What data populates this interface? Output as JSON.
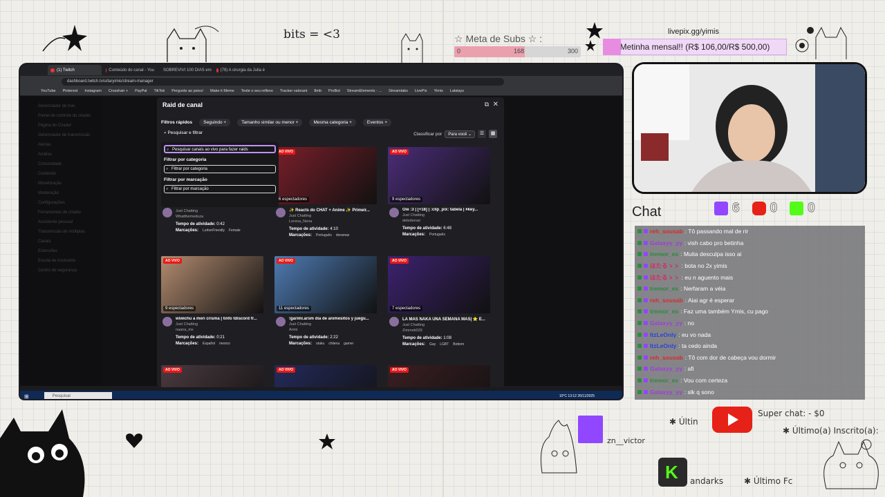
{
  "doodles": {
    "bits": "bits = <3"
  },
  "subs": {
    "title": "☆ Meta de Subs ☆ :",
    "min": "0",
    "current": "168",
    "max": "300",
    "fill_fraction": 0.56,
    "color": "#eba0ae"
  },
  "livepix": {
    "url": "livepix.gg/yimis",
    "goal": "Metinha mensal!! (R$ 106,00/R$ 500,00)"
  },
  "browser": {
    "tabs": [
      "(1) Twitch",
      "Conteúdo do canal - You",
      "SOBREVIVI 100 DIAS em",
      "(78) A cirurgia da Julia é"
    ],
    "url": "dashboard.twitch.tv/u/taryimis/stream-manager",
    "bookmarks": [
      "YouTube",
      "Pinterest",
      "Instagram",
      "Crosshair +",
      "PayPal",
      "TikTok",
      "Pergunte ao psivu!",
      "Make it Meme",
      "Teste o seu reflexo",
      "Tracker valorant",
      "8mb",
      "ProBot",
      "StreamElements - ...",
      "Streamlabs",
      "LivePix",
      "Yimis",
      "Lalalays"
    ],
    "sidebar": [
      "Gerenciador de tran.",
      "Painel de controle do criador",
      "Página do Criador",
      "Gerenciador de transmissão",
      "Alertas",
      "Análise",
      "Comunidade",
      "Conteúdo",
      "Monetização",
      "Moderação",
      "Configurações",
      "Ferramentas de criador",
      "Assistente pessoal",
      "Transmissão de múltiplas",
      "Canais",
      "Extensões",
      "Escola de Assinante",
      "Centro de segurança"
    ],
    "taskbar_search": "Pesquisar",
    "clock": "10°C  13:12  26/11/2025"
  },
  "modal": {
    "title": "Raid de canal",
    "filters_label": "Filtros rápidos",
    "chips": [
      "Seguindo +",
      "Tamanho similar ou menor +",
      "Mesma categoria +",
      "Eventos +"
    ],
    "search_filter": "Pesquisar e filtrar",
    "sort_label": "Classificar por",
    "sort_value": "Para você",
    "dropdown": {
      "search_ph": "Pesquisar canais ao vivo para fazer raids",
      "cat_label": "Filtrar por categoria",
      "cat_ph": "Filtrar por categoria",
      "tag_label": "Filtrar por marcação",
      "tag_ph": "Filtrar por marcação"
    },
    "activity_label": "Tempo de atividade:",
    "tags_label": "Marcações:",
    "live": "AO VIVO",
    "cards": [
      {
        "viewers": "",
        "title": "",
        "category": "Just Chatting",
        "user": "Whatthemeduza",
        "time": "0:42",
        "tags": [
          "LurkerFriendly",
          "Female"
        ],
        "color": "#3a2a44"
      },
      {
        "viewers": "6 espectadores",
        "title": "✨ Reacts do CHAT + Anime ✨ Primeir...",
        "category": "Just Chatting",
        "user": "Lorena_Nena",
        "time": "4:10",
        "tags": [
          "Português",
          "doramas"
        ],
        "color": "#7a1f2a"
      },
      {
        "viewers": "9 espectadores",
        "title": "Oie :3 | [+18] | :clip_pix: tabela | #key...",
        "category": "Just Chatting",
        "user": "deboboran",
        "time": "6:48",
        "tags": [
          "Português"
        ],
        "color": "#4b2d79"
      },
      {
        "viewers": "9 espectadores",
        "title": "wiwichu a meri crisma | tinfo tdiscord fr...",
        "category": "Just Chatting",
        "user": "naana_mx",
        "time": "0:21",
        "tags": [
          "Español",
          "mexico"
        ],
        "color": "#b38c70"
      },
      {
        "viewers": "11 espectadores",
        "title": "!garimi.arsm dia de animesitos y juegu...",
        "category": "Just Chatting",
        "user": "Arimi",
        "time": "2:22",
        "tags": [
          "otaku",
          "chilena",
          "gamer"
        ],
        "color": "#4e7bb3"
      },
      {
        "viewers": "7 espectadores",
        "title": "LA MAS NAKA UNA SEMANA MAS| ⭐ E...",
        "category": "Just Chatting",
        "user": "Zimmek029",
        "time": "1:08",
        "tags": [
          "Gay",
          "LGBT",
          "Bottom"
        ],
        "color": "#3d2270"
      },
      {
        "viewers": "",
        "title": "",
        "category": "",
        "user": "",
        "time": "",
        "tags": [],
        "color": "#4a3a40"
      },
      {
        "viewers": "",
        "title": "",
        "category": "",
        "user": "",
        "time": "",
        "tags": [],
        "color": "#232a5a"
      },
      {
        "viewers": "",
        "title": "",
        "category": "",
        "user": "",
        "time": "",
        "tags": [],
        "color": "#3a1e22"
      }
    ]
  },
  "chat": {
    "title": "Chat",
    "stats": [
      {
        "icon": "twitch-icon",
        "value": "6",
        "color": "#9146ff"
      },
      {
        "icon": "youtube-icon",
        "value": "0",
        "color": "#e62117"
      },
      {
        "icon": "kick-icon",
        "value": "0",
        "color": "#53fc18"
      }
    ],
    "messages": [
      {
        "user": "reh_sousab",
        "text": ": Tô passando mal de rir",
        "color": "#d62b2b"
      },
      {
        "user": "Galaxyy_yy",
        "text": ": vish cabo pro betinha",
        "color": "#9c3fd6"
      },
      {
        "user": "tremor_ex",
        "text": ": Muita desculpa isso ai",
        "color": "#2c8a3c"
      },
      {
        "user": "ほたるゝゝ",
        "text": ": bota no 2x yimis",
        "color": "#d62b63"
      },
      {
        "user": "ほたるゝゝ",
        "text": ": eu n aguento mais",
        "color": "#d62b63"
      },
      {
        "user": "tremor_ex",
        "text": ": Nerfaram a véia",
        "color": "#2c8a3c"
      },
      {
        "user": "reh_sousab",
        "text": ": Aiai agr é esperar",
        "color": "#d62b2b"
      },
      {
        "user": "tremor_ex",
        "text": ": Faz uma também Ymis, cu pago",
        "color": "#2c8a3c"
      },
      {
        "user": "Galaxyy_yy",
        "text": ": no",
        "color": "#9c3fd6"
      },
      {
        "user": "ItzLeOnly",
        "text": ": eu vo nada",
        "color": "#2a44d6"
      },
      {
        "user": "ItzLeOnly",
        "text": ": ta cedo ainda",
        "color": "#2a44d6"
      },
      {
        "user": "reh_sousab",
        "text": ": Tô com dor de cabeça vou dormir",
        "color": "#d62b2b"
      },
      {
        "user": "Galaxyy_yy",
        "text": ": afi",
        "color": "#9c3fd6"
      },
      {
        "user": "tremor_ex",
        "text": ": Vou com certeza",
        "color": "#2c8a3c"
      },
      {
        "user": "Galaxyy_yy",
        "text": ": slk q sono",
        "color": "#9c3fd6"
      }
    ]
  },
  "bottom": {
    "ultimo1": "✱ Últin",
    "superchat": "Super chat: - $0",
    "inscrito": "✱ Último(a) Inscrito(a):",
    "zn": "zn__victor",
    "andarks": "andarks",
    "ultimofc": "✱ Último Fc"
  }
}
